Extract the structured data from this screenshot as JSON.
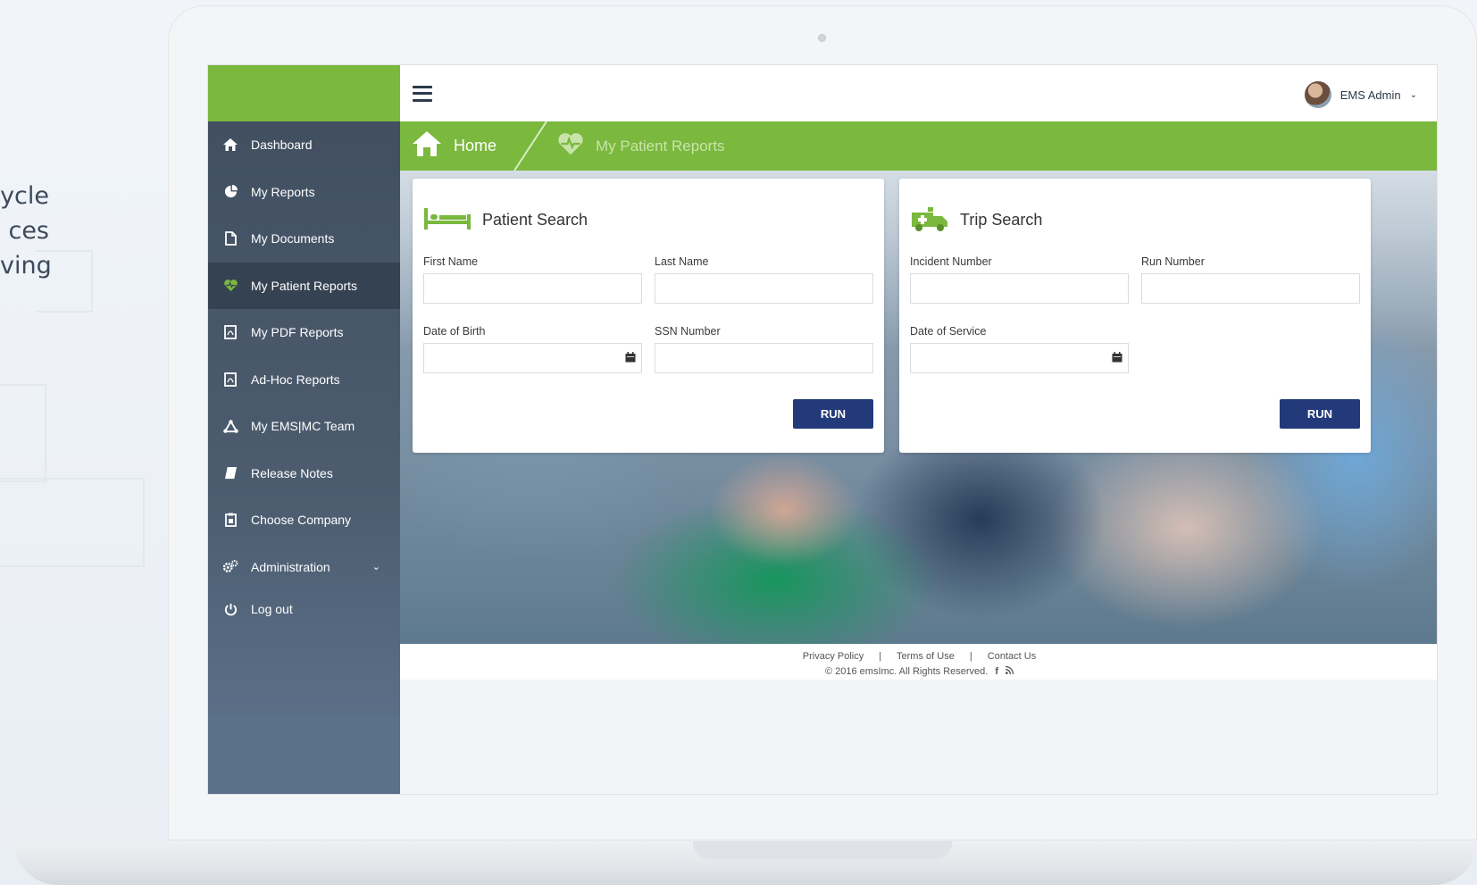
{
  "background_text": [
    "ycle",
    "ces",
    "ving"
  ],
  "topbar": {
    "user_name": "EMS Admin"
  },
  "breadcrumb": {
    "home": "Home",
    "current": "My Patient Reports"
  },
  "sidebar": {
    "items": [
      {
        "label": "Dashboard",
        "icon": "home-icon"
      },
      {
        "label": "My Reports",
        "icon": "pie-chart-icon"
      },
      {
        "label": "My Documents",
        "icon": "document-icon"
      },
      {
        "label": "My Patient Reports",
        "icon": "heart-pulse-icon",
        "active": true
      },
      {
        "label": "My PDF Reports",
        "icon": "pdf-icon"
      },
      {
        "label": "Ad-Hoc Reports",
        "icon": "pdf-icon"
      },
      {
        "label": "My EMS|MC Team",
        "icon": "team-icon"
      },
      {
        "label": "Release Notes",
        "icon": "book-icon"
      },
      {
        "label": "Choose Company",
        "icon": "clipboard-icon"
      },
      {
        "label": "Administration",
        "icon": "cogs-icon"
      },
      {
        "label": "Log out",
        "icon": "power-icon"
      }
    ]
  },
  "patient_search": {
    "title": "Patient Search",
    "first_name_label": "First Name",
    "last_name_label": "Last Name",
    "dob_label": "Date of Birth",
    "ssn_label": "SSN Number",
    "run_label": "RUN"
  },
  "trip_search": {
    "title": "Trip Search",
    "incident_label": "Incident Number",
    "run_number_label": "Run Number",
    "date_of_service_label": "Date of Service",
    "run_label": "RUN"
  },
  "footer": {
    "privacy": "Privacy Policy",
    "separator": "|",
    "terms": "Terms of Use",
    "contact": "Contact Us",
    "copyright": "© 2016 emsImc. All Rights Reserved."
  },
  "colors": {
    "brand_green": "#7ab83e",
    "sidebar": "#3f4d5e",
    "run_button": "#233a7a"
  }
}
